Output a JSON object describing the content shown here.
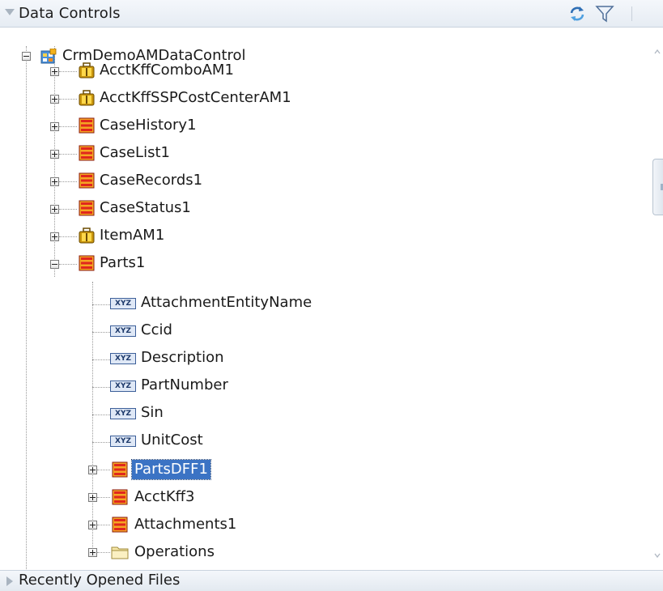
{
  "panel": {
    "title": "Data Controls",
    "refresh_icon": "refresh-icon",
    "filter_icon": "filter-icon"
  },
  "tree": {
    "root": {
      "label": "CrmDemoAMDataControl",
      "icon": "data-control-icon",
      "expanded": true
    },
    "children": [
      {
        "label": "AcctKffComboAM1",
        "icon": "application-module-icon",
        "expanded": false
      },
      {
        "label": "AcctKffSSPCostCenterAM1",
        "icon": "application-module-icon",
        "expanded": false
      },
      {
        "label": "CaseHistory1",
        "icon": "collection-icon",
        "expanded": false
      },
      {
        "label": "CaseList1",
        "icon": "collection-icon",
        "expanded": false
      },
      {
        "label": "CaseRecords1",
        "icon": "collection-icon",
        "expanded": false
      },
      {
        "label": "CaseStatus1",
        "icon": "collection-icon",
        "expanded": false
      },
      {
        "label": "ItemAM1",
        "icon": "application-module-icon",
        "expanded": false
      },
      {
        "label": "Parts1",
        "icon": "collection-icon",
        "expanded": true
      }
    ],
    "parts_attributes": [
      {
        "label": "AttachmentEntityName",
        "icon": "attribute-icon"
      },
      {
        "label": "Ccid",
        "icon": "attribute-icon"
      },
      {
        "label": "Description",
        "icon": "attribute-icon"
      },
      {
        "label": "PartNumber",
        "icon": "attribute-icon"
      },
      {
        "label": "Sin",
        "icon": "attribute-icon"
      },
      {
        "label": "UnitCost",
        "icon": "attribute-icon"
      }
    ],
    "parts_children": [
      {
        "label": "PartsDFF1",
        "icon": "collection-icon",
        "expanded": false,
        "selected": true
      },
      {
        "label": "AcctKff3",
        "icon": "collection-icon",
        "expanded": false
      },
      {
        "label": "Attachments1",
        "icon": "collection-icon",
        "expanded": false
      },
      {
        "label": "Operations",
        "icon": "folder-icon",
        "expanded": false
      }
    ],
    "attribute_badge": "XYZ"
  },
  "footer": {
    "title": "Recently Opened Files"
  },
  "colors": {
    "selection": "#3b73c4",
    "collection_red": "#e0271d",
    "collection_orange": "#f5a623",
    "module_gold": "#b8860b"
  }
}
